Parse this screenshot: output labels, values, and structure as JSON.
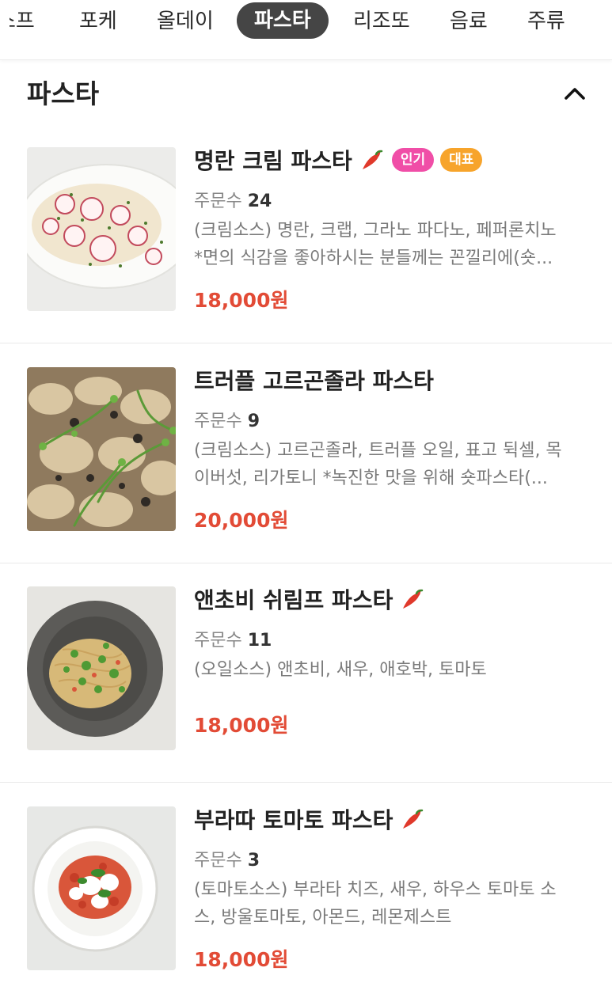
{
  "tabs": [
    {
      "label": "스프",
      "active": false
    },
    {
      "label": "포케",
      "active": false
    },
    {
      "label": "올데이",
      "active": false
    },
    {
      "label": "파스타",
      "active": true
    },
    {
      "label": "리조또",
      "active": false
    },
    {
      "label": "음료",
      "active": false
    },
    {
      "label": "주류",
      "active": false
    }
  ],
  "section": {
    "title": "파스타",
    "collapse_icon": "chevron-up-icon"
  },
  "orders_label": "주문수",
  "items": [
    {
      "name": "명란 크림 파스타",
      "spicy": true,
      "badges": [
        {
          "label": "인기",
          "color": "#f04ea7"
        },
        {
          "label": "대표",
          "color": "#f7a42b"
        }
      ],
      "orders": "24",
      "desc_lines": [
        "(크림소스) 명란, 크랩, 그라노 파다노, 페퍼론치노",
        "*면의 식감을 좋아하시는 분들께는 꼰낄리에(숏..."
      ],
      "price": "18,000원"
    },
    {
      "name": "트러플 고르곤졸라 파스타",
      "spicy": false,
      "badges": [],
      "orders": "9",
      "desc_lines": [
        "(크림소스) 고르곤졸라, 트러플 오일, 표고 뒥셀, 목",
        "이버섯, 리가토니 *녹진한 맛을 위해 숏파스타(..."
      ],
      "price": "20,000원"
    },
    {
      "name": "앤초비 쉬림프 파스타",
      "spicy": true,
      "badges": [],
      "orders": "11",
      "desc_lines": [
        "(오일소스) 앤초비, 새우, 애호박, 토마토"
      ],
      "price": "18,000원"
    },
    {
      "name": "부라따 토마토 파스타",
      "spicy": true,
      "badges": [],
      "orders": "3",
      "desc_lines": [
        "(토마토소스) 부라타 치즈, 새우, 하우스 토마토 소",
        "스, 방울토마토, 아몬드, 레몬제스트"
      ],
      "price": "18,000원"
    }
  ],
  "colors": {
    "active_tab_bg": "#454545",
    "price": "#e24b36",
    "badge_popular": "#f04ea7",
    "badge_signature": "#f7a42b",
    "chili": "#e0392b"
  }
}
